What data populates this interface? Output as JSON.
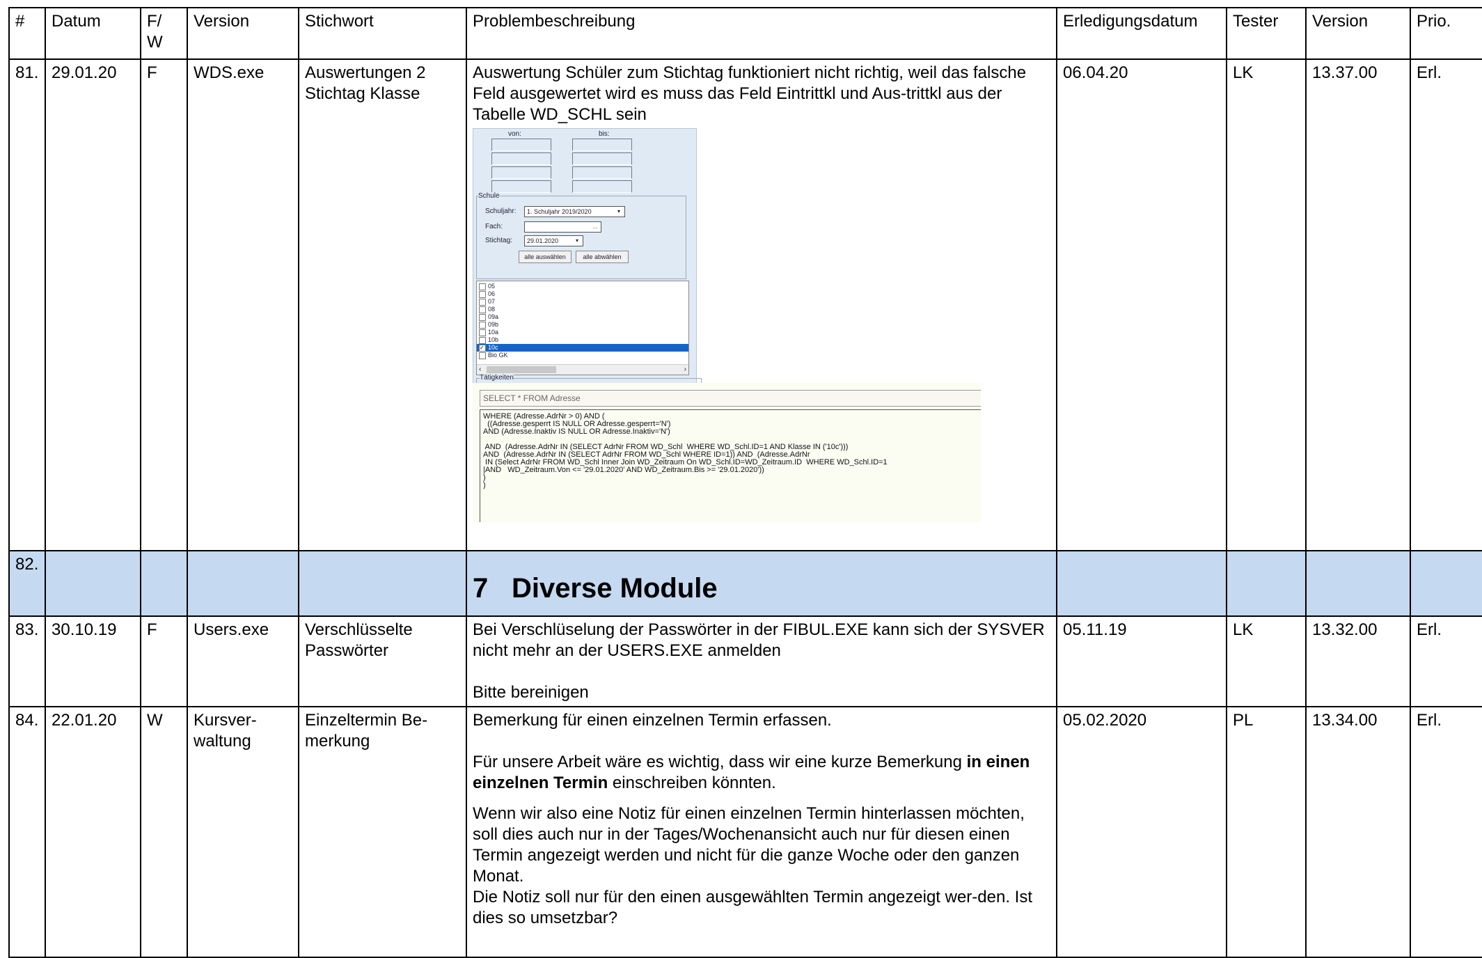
{
  "headers": [
    "#",
    "Datum",
    "F/ W",
    "Version",
    "Stichwort",
    "Problembeschreibung",
    "Erledigungsdatum",
    "Tester",
    "Version",
    "Prio."
  ],
  "rows": [
    {
      "num": "81.",
      "datum": "29.01.20",
      "fw": "F",
      "version": "WDS.exe",
      "stichwort": "Auswertungen 2 Stichtag Klasse",
      "problem": "Auswertung Schüler zum Stichtag funktioniert nicht richtig, weil das falsche Feld ausgewertet wird es muss das Feld Eintrittkl und Aus-trittkl aus der Tabelle WD_SCHL sein",
      "erledigt": "06.04.20",
      "tester": "LK",
      "version2": "13.37.00",
      "prio": "Erl."
    },
    {
      "num": "83.",
      "datum": "30.10.19",
      "fw": "F",
      "version": "Users.exe",
      "stichwort": "Verschlüsselte Passwörter",
      "problem_p1": "Bei Verschlüselung der Passwörter in der FIBUL.EXE kann sich der SYSVER nicht mehr an der USERS.EXE anmelden",
      "problem_p2": "Bitte bereinigen",
      "erledigt": "05.11.19",
      "tester": "LK",
      "version2": "13.32.00",
      "prio": "Erl."
    },
    {
      "num": "84.",
      "datum": "22.01.20",
      "fw": "W",
      "version": "Kursver-waltung",
      "stichwort": "Einzeltermin Be-merkung",
      "problem_p1": "Bemerkung für einen einzelnen Termin erfassen.",
      "problem_p2_a": "Für unsere Arbeit wäre es wichtig, dass wir eine kurze Bemerkung ",
      "problem_p2_b": "in einen einzelnen Termin",
      "problem_p2_c": " einschreiben könnten.",
      "problem_p3": "Wenn wir also eine Notiz für einen einzelnen Termin hinterlassen möchten, soll dies auch nur in der Tages/Wochenansicht auch nur für diesen einen Termin angezeigt werden und nicht für die ganze Woche oder den ganzen Monat.",
      "problem_p4": "Die Notiz soll nur für den einen ausgewählten Termin angezeigt wer-den. Ist dies so umsetzbar?",
      "erledigt": "05.02.2020",
      "tester": "PL",
      "version2": "13.34.00",
      "prio": "Erl."
    }
  ],
  "section": {
    "num": "82.",
    "heading_num": "7",
    "heading": "Diverse Module"
  },
  "screenshot": {
    "von": "von:",
    "bis": "bis:",
    "group": "Schule",
    "schuljahr_label": "Schuljahr:",
    "schuljahr_value": "1. Schuljahr 2019/2020",
    "fach_label": "Fach:",
    "fach_button": "...",
    "stichtag_label": "Stichtag:",
    "stichtag_value": "29.01.2020",
    "btn_select_all": "alle auswählen",
    "btn_deselect_all": "alle abwählen",
    "classes": [
      "05",
      "06",
      "07",
      "08",
      "09a",
      "09b",
      "10a",
      "10b",
      "10c",
      "Bio GK"
    ],
    "selected_class": "10c",
    "taetigkeiten": "Tätigkeiten",
    "sql_select": "SELECT * FROM Adresse",
    "sql_where": "WHERE (Adresse.AdrNr > 0) AND (\n  ((Adresse.gesperrt IS NULL OR Adresse.gesperrt='N')\nAND (Adresse.Inaktiv IS NULL OR Adresse.Inaktiv='N')\n\n AND  (Adresse.AdrNr IN (SELECT AdrNr FROM WD_Schl  WHERE WD_Schl.ID=1 AND Klasse IN ('10c')))\nAND  (Adresse.AdrNr IN (SELECT AdrNr FROM WD_Schl WHERE ID=1)) AND  (Adresse.AdrNr\n IN (Select AdrNr FROM WD_Schl Inner Join WD_Zeitraum On WD_Schl.ID=WD_Zeitraum.ID  WHERE WD_Schl.ID=1\n|AND   WD_Zeitraum.Von <= '29.01.2020' AND WD_Zeitraum.Bis >= '29.01.2020'))\n)\n)"
  }
}
